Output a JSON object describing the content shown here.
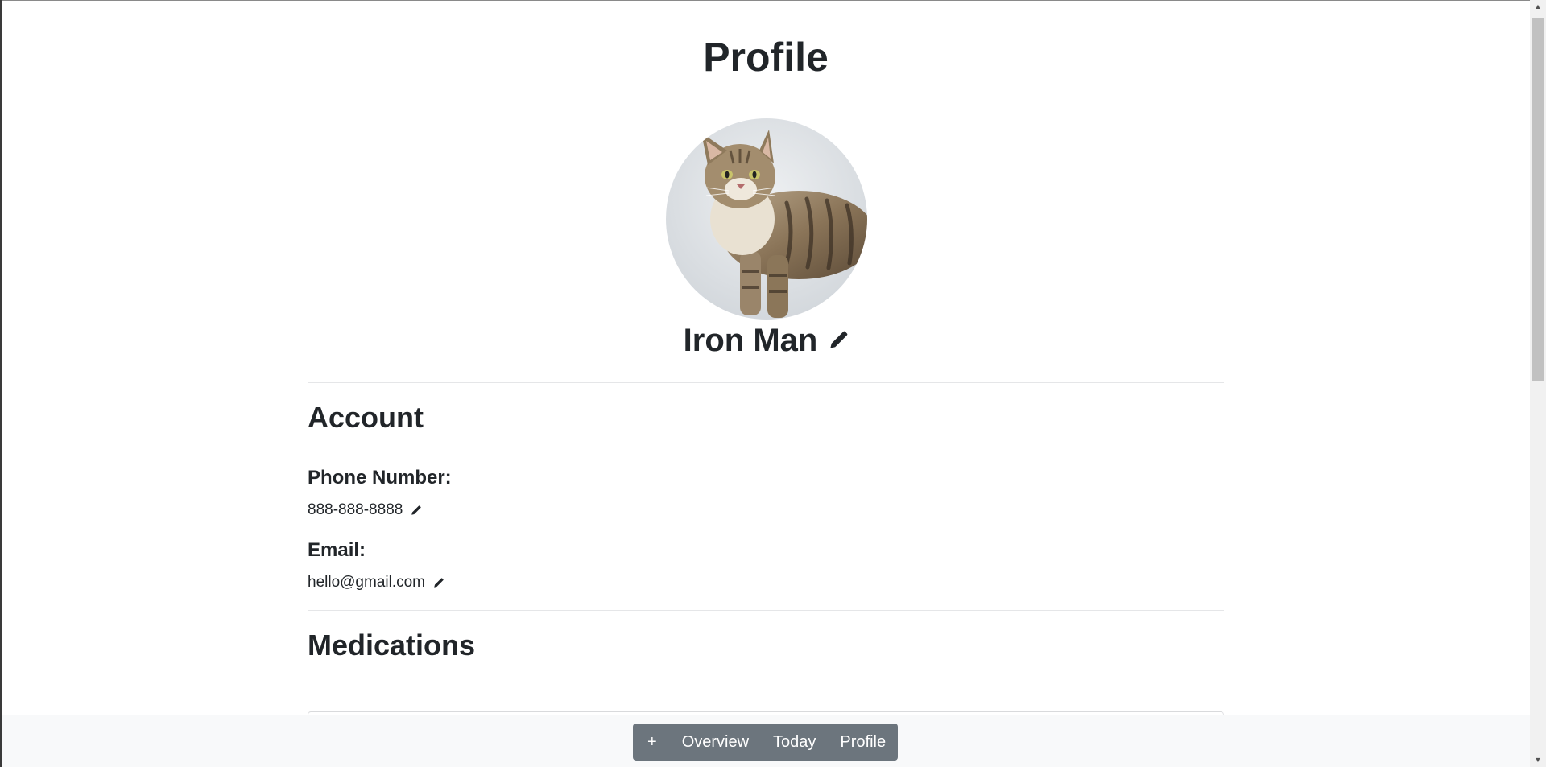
{
  "page": {
    "title": "Profile"
  },
  "profile": {
    "name": "Iron Man",
    "avatar_alt": "tabby cat photo"
  },
  "account": {
    "heading": "Account",
    "phone_label": "Phone Number:",
    "phone_value": "888-888-8888",
    "email_label": "Email:",
    "email_value": "hello@gmail.com"
  },
  "medications": {
    "heading": "Medications"
  },
  "bottom_nav": {
    "add_label": "+",
    "overview_label": "Overview",
    "today_label": "Today",
    "profile_label": "Profile"
  },
  "icons": {
    "edit": "pencil-icon",
    "scroll_up": "arrow-up-icon",
    "scroll_down": "arrow-down-icon"
  },
  "colors": {
    "nav_button_bg": "#6c757d",
    "bottom_bar_bg": "#f8f9fa",
    "text": "#212529",
    "divider": "#e5e6e8"
  }
}
